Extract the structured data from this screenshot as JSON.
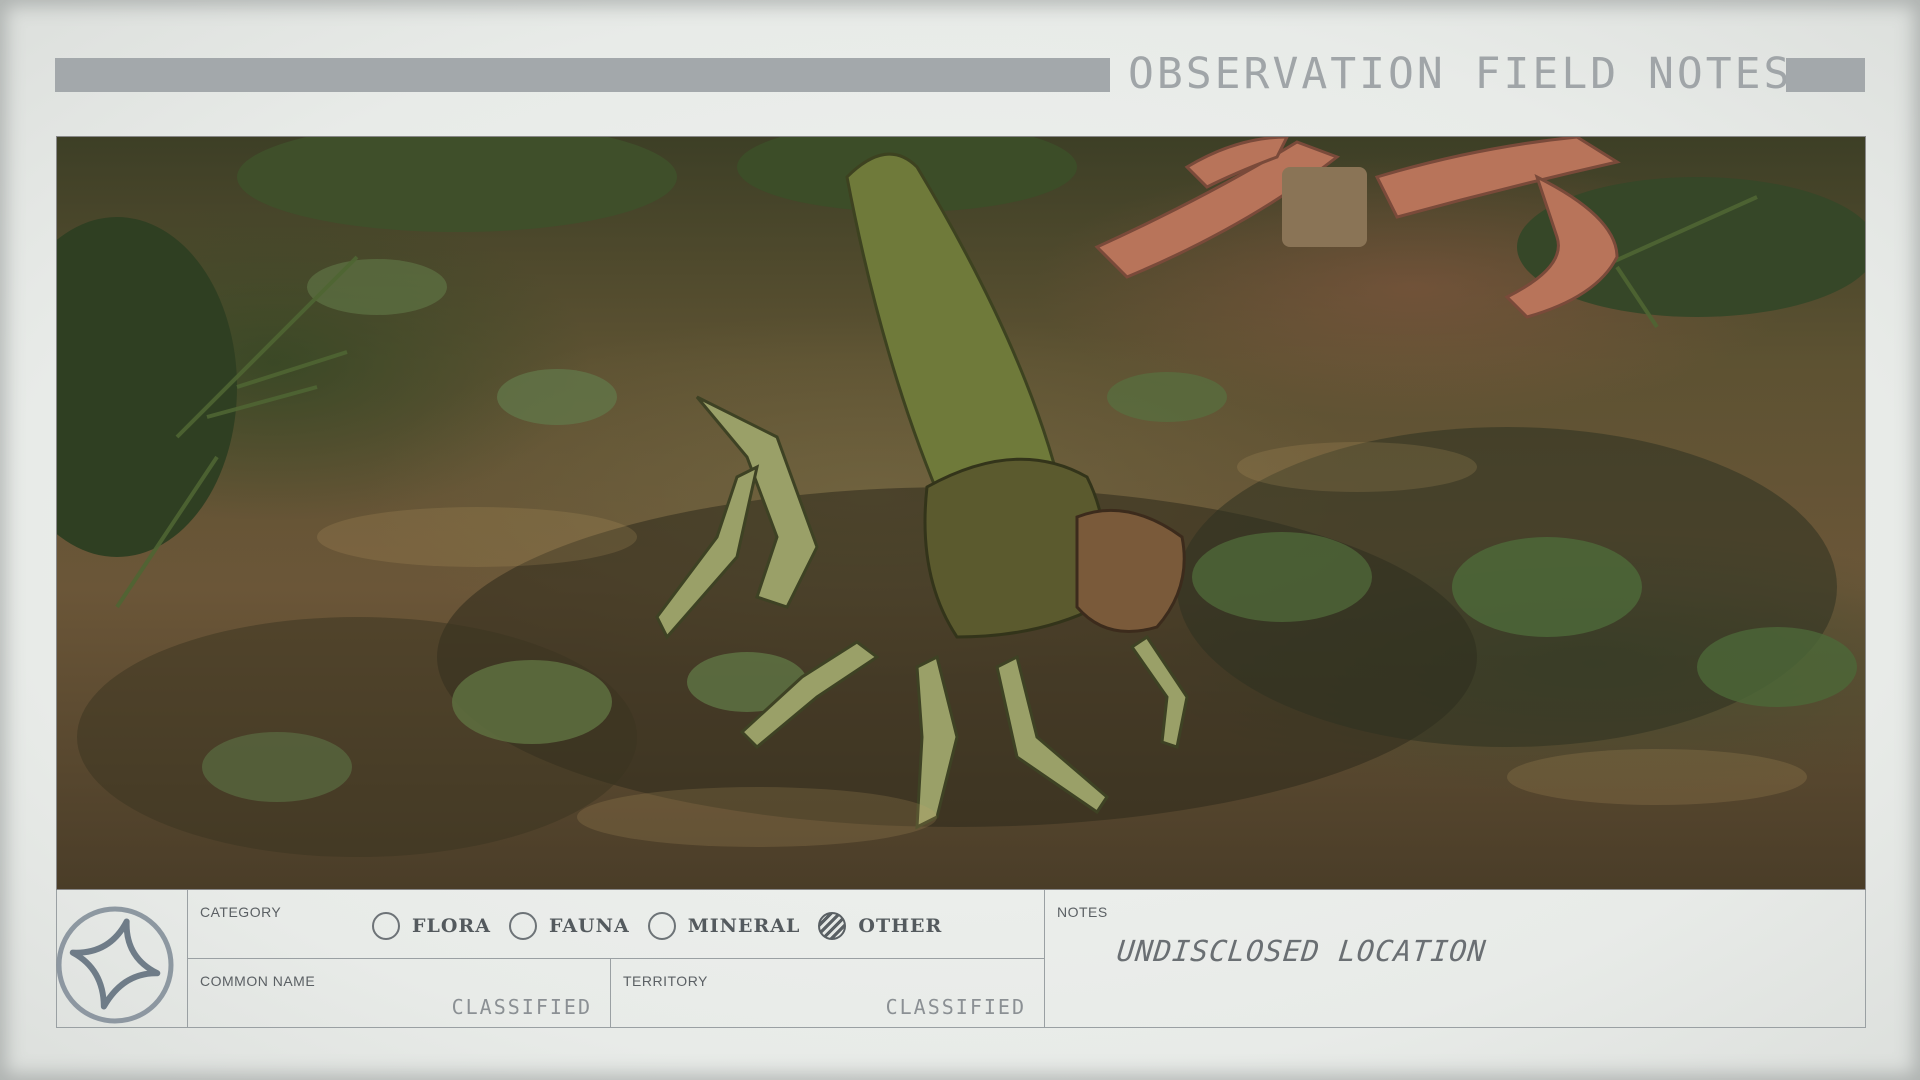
{
  "header": {
    "title": "OBSERVATION FIELD NOTES"
  },
  "scene": {
    "subject_icon": "alien-creature-image"
  },
  "category": {
    "label": "CATEGORY",
    "options": [
      {
        "label": "FLORA",
        "selected": false
      },
      {
        "label": "FAUNA",
        "selected": false
      },
      {
        "label": "MINERAL",
        "selected": false
      },
      {
        "label": "OTHER",
        "selected": true
      }
    ]
  },
  "common_name": {
    "label": "COMMON NAME",
    "value": "CLASSIFIED"
  },
  "territory": {
    "label": "TERRITORY",
    "value": "CLASSIFIED"
  },
  "notes": {
    "label": "NOTES",
    "value": "UNDISCLOSED LOCATION"
  },
  "colors": {
    "paper": "#eceeec",
    "ink": "#545a5e",
    "stamp": "#7e8a95"
  }
}
